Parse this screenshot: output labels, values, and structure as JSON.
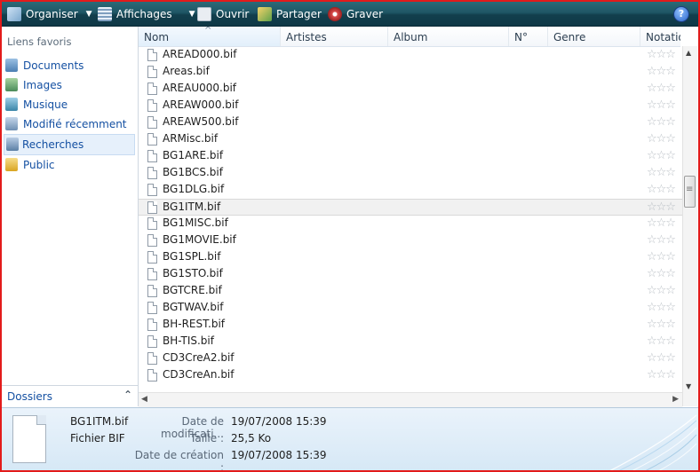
{
  "toolbar": {
    "organiser": "Organiser",
    "affichages": "Affichages",
    "ouvrir": "Ouvrir",
    "partager": "Partager",
    "graver": "Graver",
    "help": "?"
  },
  "sidebar": {
    "favorites_title": "Liens favoris",
    "items": [
      {
        "label": "Documents"
      },
      {
        "label": "Images"
      },
      {
        "label": "Musique"
      },
      {
        "label": "Modifié récemment"
      },
      {
        "label": "Recherches"
      },
      {
        "label": "Public"
      }
    ],
    "selected": "Recherches",
    "folders_label": "Dossiers",
    "folders_chevron": "⌃"
  },
  "columns": [
    "Nom",
    "Artistes",
    "Album",
    "N°",
    "Genre",
    "Notation"
  ],
  "files": [
    "AREAD000.bif",
    "Areas.bif",
    "AREAU000.bif",
    "AREAW000.bif",
    "AREAW500.bif",
    "ARMisc.bif",
    "BG1ARE.bif",
    "BG1BCS.bif",
    "BG1DLG.bif",
    "BG1ITM.bif",
    "BG1MISC.bif",
    "BG1MOVIE.bif",
    "BG1SPL.bif",
    "BG1STO.bif",
    "BGTCRE.bif",
    "BGTWAV.bif",
    "BH-REST.bif",
    "BH-TIS.bif",
    "CD3CreA2.bif",
    "CD3CreAn.bif"
  ],
  "selected_file": "BG1ITM.bif",
  "stars": "☆☆☆",
  "details": {
    "name": "BG1ITM.bif",
    "type": "Fichier BIF",
    "modified_label": "Date de modificati...",
    "modified_value": "19/07/2008 15:39",
    "size_label": "Taille :",
    "size_value": "25,5 Ko",
    "created_label": "Date de création :",
    "created_value": "19/07/2008 15:39"
  },
  "colors": {
    "toolbar": "#1f5665",
    "link": "#1450a2",
    "frame_border": "#e31b1b"
  }
}
